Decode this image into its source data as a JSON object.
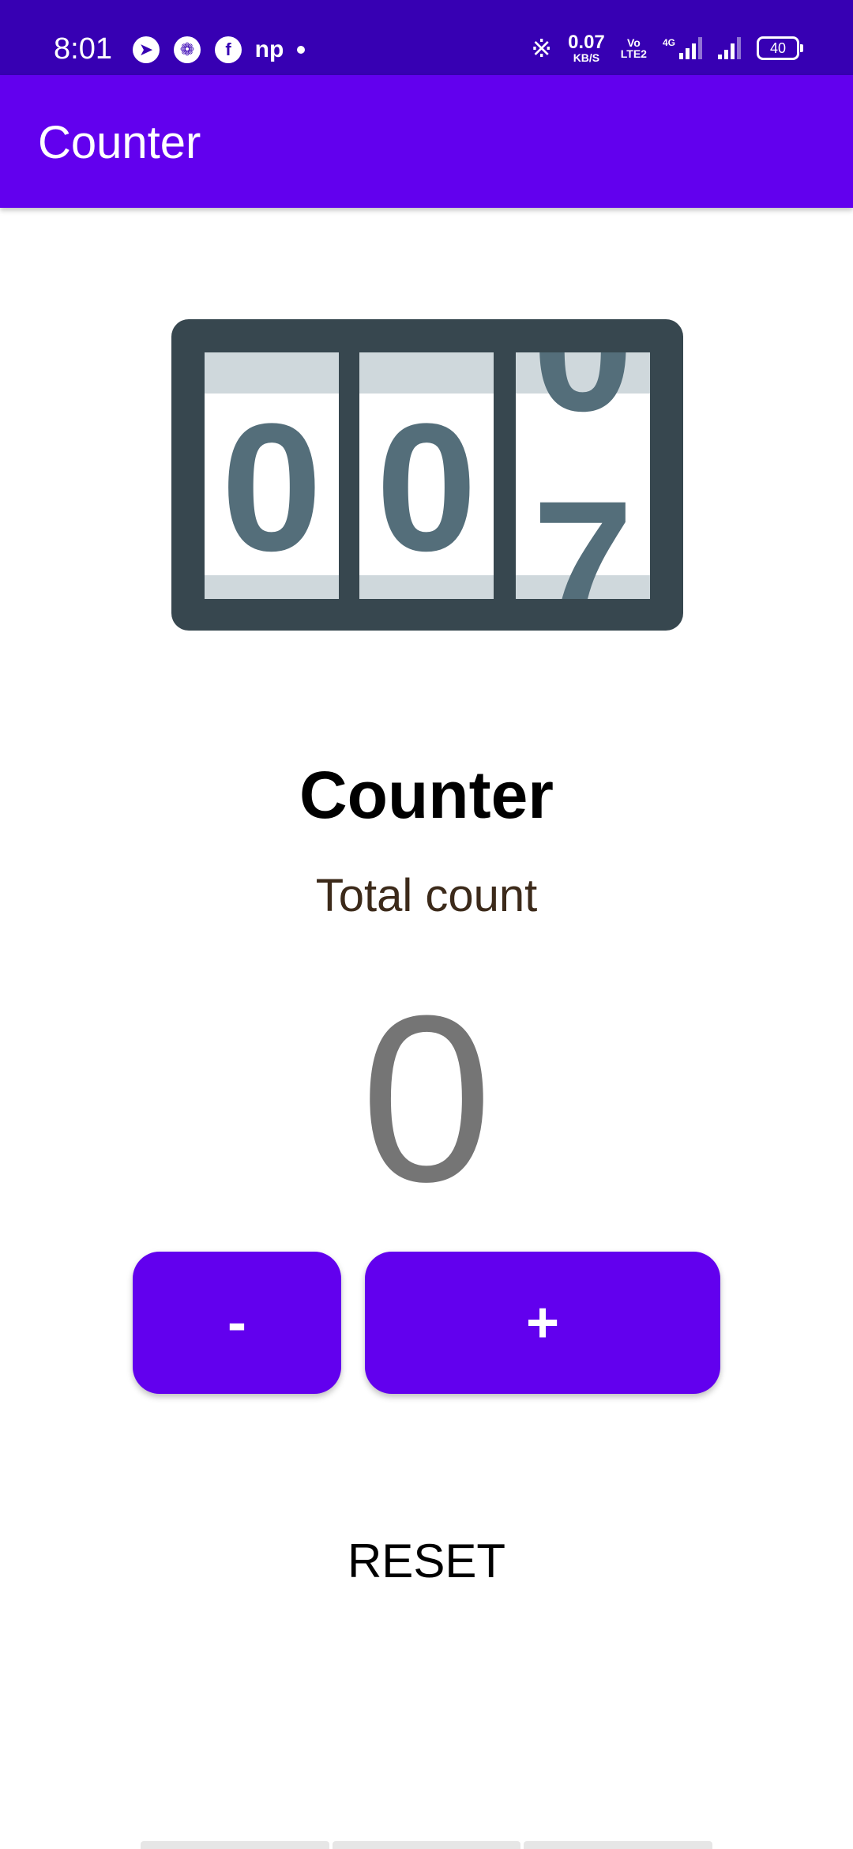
{
  "status_bar": {
    "time": "8:01",
    "left_icons": [
      "telegram-icon",
      "pinwheel-app-icon",
      "facebook-icon",
      "np-app-icon",
      "notification-dot"
    ],
    "np_label": "np",
    "net_speed_value": "0.07",
    "net_speed_unit": "KB/S",
    "volte_top": "Vo",
    "volte_bottom": "LTE2",
    "network_type": "4G",
    "battery_level": "40"
  },
  "app_bar": {
    "title": "Counter"
  },
  "content": {
    "title": "Counter",
    "subtitle": "Total count",
    "count_value": "0"
  },
  "graphic": {
    "digits": [
      "0",
      "0",
      "7"
    ],
    "partial_top_digit": "0"
  },
  "buttons": {
    "decrement_label": "-",
    "increment_label": "+",
    "reset_label": "RESET"
  },
  "colors": {
    "status_bar": "#3700b3",
    "primary": "#6200ee",
    "graphic_frame": "#37474f",
    "graphic_digit": "#546e7a",
    "graphic_band": "#cfd8dc",
    "count_text": "#757575"
  }
}
